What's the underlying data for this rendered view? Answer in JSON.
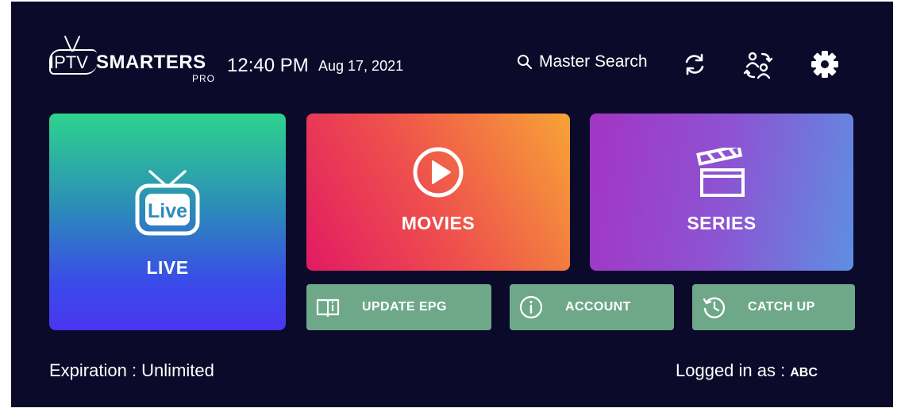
{
  "header": {
    "logo_iptv": "IPTV",
    "logo_smarters": "SMARTERS",
    "logo_pro": "PRO",
    "time": "12:40 PM",
    "date": "Aug 17, 2021",
    "search_label": "Master Search",
    "icons": [
      "search-icon",
      "refresh-icon",
      "switch-user-icon",
      "gear-icon"
    ]
  },
  "tiles": {
    "live": {
      "label": "LIVE",
      "icon_text": "Live"
    },
    "movies": {
      "label": "MOVIES"
    },
    "series": {
      "label": "SERIES"
    }
  },
  "buttons": {
    "update_epg": "UPDATE EPG",
    "account": "ACCOUNT",
    "catch_up": "CATCH UP"
  },
  "footer": {
    "expiration": "Expiration : Unlimited",
    "logged_in_label": "Logged in as :",
    "username": "ABC"
  },
  "colors": {
    "background": "#0b0a2a",
    "button_green": "#6ea889",
    "live_top": "#2ed38e",
    "live_bottom": "#4936f0",
    "movies_start": "#e21a63",
    "movies_end": "#f7a336",
    "series_start": "#a334c4",
    "series_end": "#5e8ee2"
  }
}
